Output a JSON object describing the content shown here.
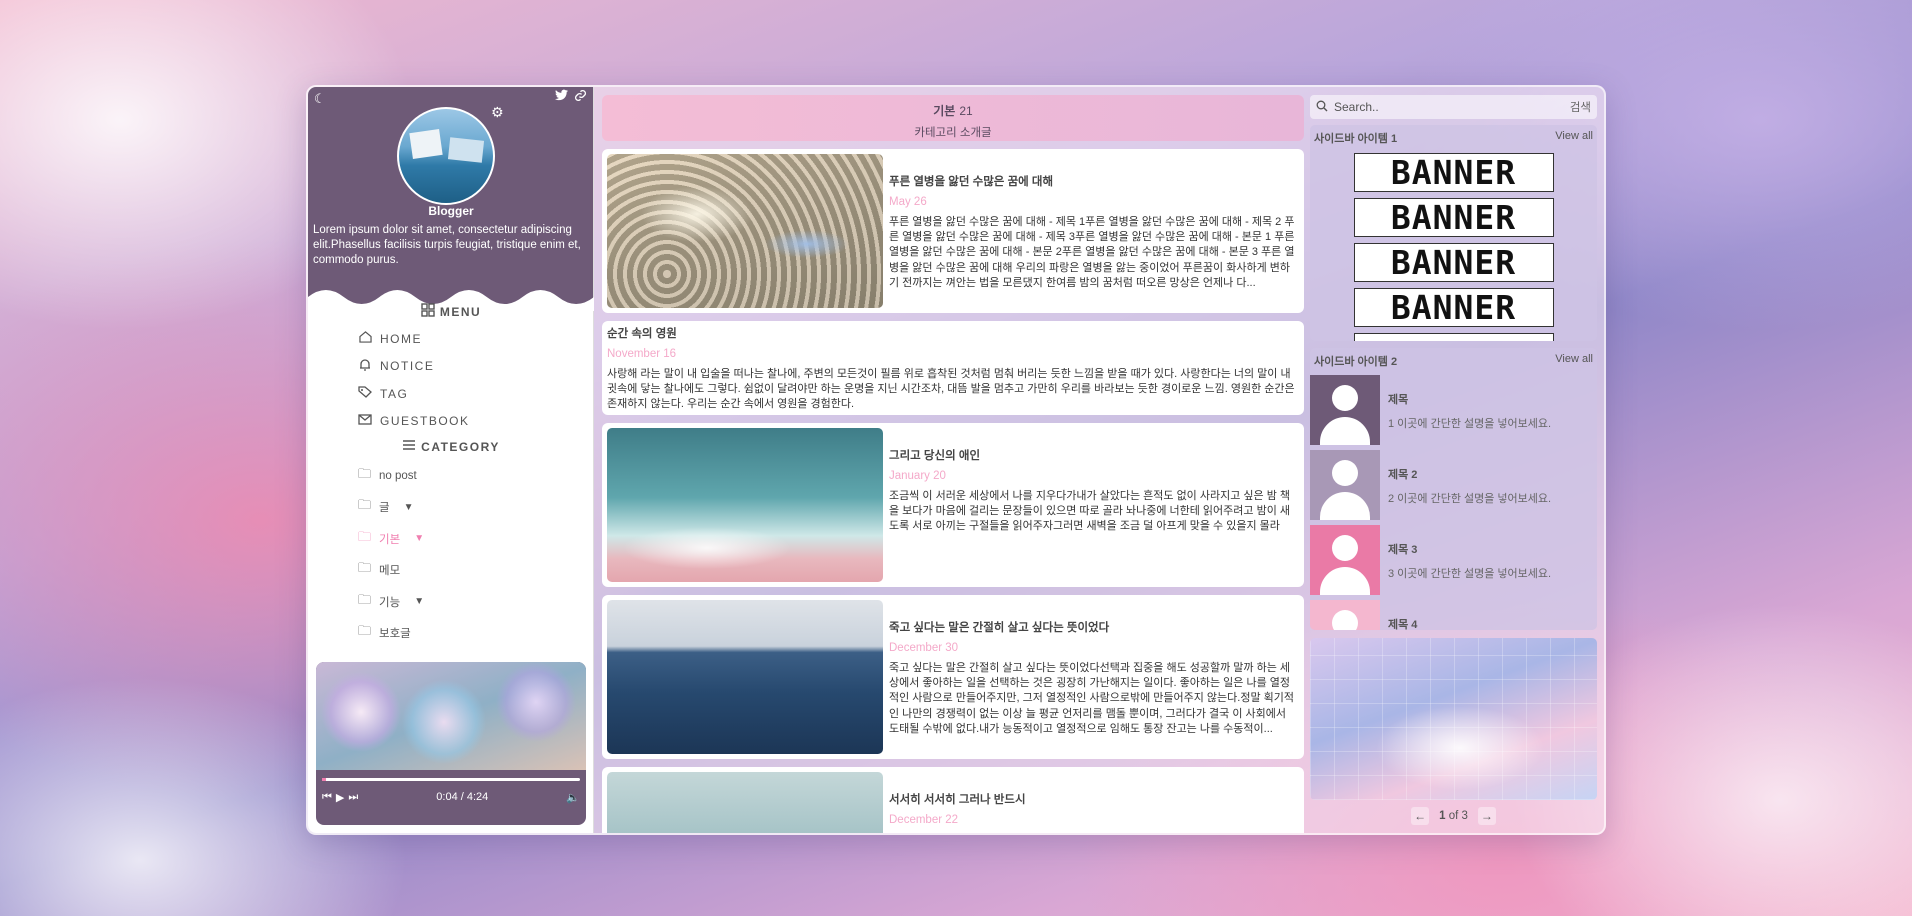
{
  "profile": {
    "name": "Blogger",
    "bio": "Lorem ipsum dolor sit amet, consectetur adipiscing elit.Phasellus facilisis turpis feugiat, tristique enim et, commodo purus."
  },
  "menu": {
    "title": "MENU",
    "items": [
      {
        "label": "HOME",
        "icon": "home-icon"
      },
      {
        "label": "NOTICE",
        "icon": "bell-icon"
      },
      {
        "label": "TAG",
        "icon": "tag-icon"
      },
      {
        "label": "GUESTBOOK",
        "icon": "mail-icon"
      }
    ]
  },
  "category": {
    "title": "CATEGORY",
    "items": [
      {
        "label": "no post"
      },
      {
        "label": "글"
      },
      {
        "label": "기본"
      },
      {
        "label": "메모"
      },
      {
        "label": "기능"
      },
      {
        "label": "보호글"
      }
    ]
  },
  "player": {
    "time": "0:04 / 4:24",
    "progress": 0.016
  },
  "header": {
    "category": "기본",
    "count": "21",
    "description": "카테고리 소개글"
  },
  "posts": [
    {
      "title": "푸른 열병을 앓던 수많은 꿈에 대해",
      "date": "May 26",
      "summary": "푸른 열병을 앓던 수많은 꿈에 대해 - 제목 1푸른 열병을 앓던 수많은 꿈에 대해 - 제목 2 푸른 열병을 앓던 수많은 꿈에 대해 - 제목 3푸른 열병을 앓던 수많은 꿈에 대해 - 본문 1 푸른 열병을 앓던 수많은 꿈에 대해 - 본문 2푸른 열병을 앓던 수많은 꿈에 대해 - 본문 3 푸른 열병을 앓던 수많은 꿈에 대해 우리의 파랑은 열병을 앓는 중이었어 푸른꿈이 화사하게 변하기 전까지는 껴안는 법을 모른댔지 한여름 밤의 꿈처럼 떠오른 망상은 언제나 다..."
    },
    {
      "title": "순간 속의 영원",
      "date": "November 16",
      "summary": "사랑해 라는 말이 내 입술을 떠나는 찰나에, 주변의 모든것이 필름 위로 흡착된 것처럼 멈춰 버리는 듯한 느낌을 받을 때가 있다. 사랑한다는 너의 말이 내 귓속에 닿는 찰나에도 그렇다. 쉼없이 달려야만 하는 운명을 지닌 시간조차, 대뜸 발을 멈추고 가만히 우리를 바라보는 듯한 경이로운 느낌. 영원한 순간은 존재하지 않는다. 우리는 순간 속에서 영원을 경험한다."
    },
    {
      "title": "그리고 당신의 애인",
      "date": "January 20",
      "summary": "조금씩 이 서러운 세상에서 나를 지우다가내가 살았다는 흔적도 없이 사라지고 싶은 밤 책을 보다가 마음에 걸리는 문장들이 있으면 따로 골라 놔나중에 너한테 읽어주려고 밤이 새도록 서로 아끼는 구절들을 읽어주자그러면 새벽을 조금 덜 아프게 맞을 수 있을지 몰라"
    },
    {
      "title": "죽고 싶다는 말은 간절히 살고 싶다는 뜻이었다",
      "date": "December 30",
      "summary": "죽고 싶다는 말은 간절히 살고 싶다는 뜻이었다선택과 집중을 해도 성공할까 말까 하는 세상에서 좋아하는 일을 선택하는 것은 굉장히 가난해지는 일이다. 좋아하는 일은 나를 열정적인 사람으로 만들어주지만, 그저 열정적인 사람으로밖에 만들어주지 않는다.정말 획기적인 나만의 경쟁력이 없는 이상 늘 평균 언저리를 맴돌 뿐이며, 그러다가 결국 이 사회에서 도태될 수밖에 없다.내가 능동적이고 열정적으로 임해도 통장 잔고는 나를 수동적이..."
    },
    {
      "title": "서서히 서서히 그러나 반드시",
      "date": "December 22",
      "summary": ""
    }
  ],
  "search": {
    "placeholder": "Search..",
    "button": "검색"
  },
  "widget1": {
    "title": "사이드바 아이템 1",
    "view_all": "View all",
    "banners": [
      "BANNER",
      "BANNER",
      "BANNER",
      "BANNER"
    ]
  },
  "widget2": {
    "title": "사이드바 아이템 2",
    "view_all": "View all",
    "items": [
      {
        "title": "제목",
        "desc": "1 이곳에 간단한 설명을 넣어보세요.",
        "color": "#6e5a77"
      },
      {
        "title": "제목 2",
        "desc": "2 이곳에 간단한 설명을 넣어보세요.",
        "color": "#a898b6"
      },
      {
        "title": "제목 3",
        "desc": "3 이곳에 간단한 설명을 넣어보세요.",
        "color": "#ea7aa6"
      },
      {
        "title": "제목 4",
        "desc": "",
        "color": "#f4b7cf"
      }
    ]
  },
  "pager": {
    "current": "1",
    "of_label": "of",
    "total": "3"
  },
  "colors": {
    "accent": "#f07fb0",
    "profile_bg": "#6e5a77"
  }
}
